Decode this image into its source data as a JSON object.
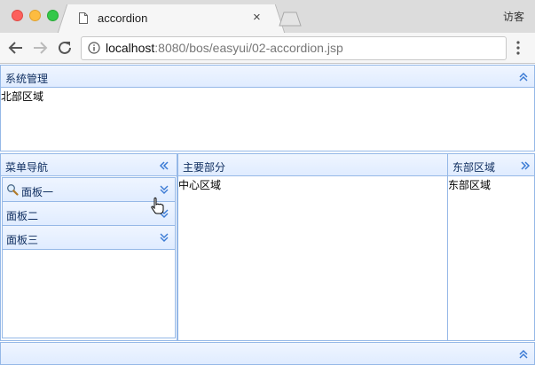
{
  "browser": {
    "tab_title": "accordion",
    "tab_close": "×",
    "profile": "访客",
    "url_host": "localhost",
    "url_rest": ":8080/bos/easyui/02-accordion.jsp",
    "accent": "#95b8e7"
  },
  "layout": {
    "north": {
      "title": "系统管理",
      "content": "北部区域"
    },
    "west": {
      "title": "菜单导航",
      "panels": [
        {
          "title": "面板一",
          "icon": "search-icon"
        },
        {
          "title": "面板二"
        },
        {
          "title": "面板三"
        }
      ]
    },
    "center": {
      "title": "主要部分",
      "content": "中心区域"
    },
    "east": {
      "title": "东部区域",
      "content": "东部区域"
    },
    "south": {
      "title": ""
    }
  }
}
